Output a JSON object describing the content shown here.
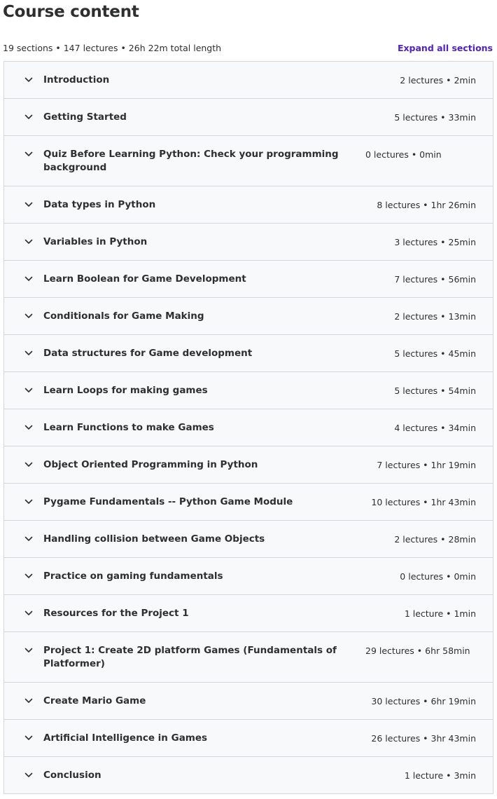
{
  "header": {
    "title": "Course content",
    "summary": "19 sections • 147 lectures • 26h 22m total length",
    "expand_label": "Expand all sections"
  },
  "icons": {
    "chevron": "chevron-down-icon"
  },
  "sections": [
    {
      "title": "Introduction",
      "meta": "2 lectures • 2min"
    },
    {
      "title": "Getting Started",
      "meta": "5 lectures • 33min"
    },
    {
      "title": "Quiz Before Learning Python: Check your programming background",
      "meta": "0 lectures • 0min"
    },
    {
      "title": "Data types in Python",
      "meta": "8 lectures • 1hr 26min"
    },
    {
      "title": "Variables in Python",
      "meta": "3 lectures • 25min"
    },
    {
      "title": "Learn Boolean for Game Development",
      "meta": "7 lectures • 56min"
    },
    {
      "title": "Conditionals for Game Making",
      "meta": "2 lectures • 13min"
    },
    {
      "title": "Data structures for Game development",
      "meta": "5 lectures • 45min"
    },
    {
      "title": "Learn Loops for making games",
      "meta": "5 lectures • 54min"
    },
    {
      "title": "Learn Functions to make Games",
      "meta": "4 lectures • 34min"
    },
    {
      "title": "Object Oriented Programming in Python",
      "meta": "7 lectures • 1hr 19min"
    },
    {
      "title": "Pygame Fundamentals -- Python Game Module",
      "meta": "10 lectures • 1hr 43min"
    },
    {
      "title": "Handling collision between Game Objects",
      "meta": "2 lectures • 28min"
    },
    {
      "title": "Practice on gaming fundamentals",
      "meta": "0 lectures • 0min"
    },
    {
      "title": "Resources for the Project 1",
      "meta": "1 lecture • 1min"
    },
    {
      "title": "Project 1: Create 2D platform Games (Fundamentals of Platformer)",
      "meta": "29 lectures • 6hr 58min"
    },
    {
      "title": "Create Mario Game",
      "meta": "30 lectures • 6hr 19min"
    },
    {
      "title": "Artificial Intelligence in Games",
      "meta": "26 lectures • 3hr 43min"
    },
    {
      "title": "Conclusion",
      "meta": "1 lecture • 3min"
    }
  ]
}
